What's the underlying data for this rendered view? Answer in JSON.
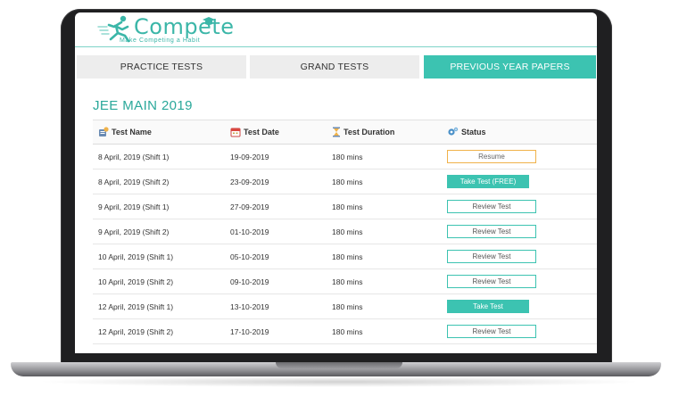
{
  "brand": {
    "name": "Compete",
    "tagline": "Make Competing a Habit",
    "accent": "#3cc3b1"
  },
  "tabs": [
    {
      "label": "PRACTICE TESTS",
      "active": false
    },
    {
      "label": "GRAND TESTS",
      "active": false
    },
    {
      "label": "PREVIOUS YEAR PAPERS",
      "active": true
    }
  ],
  "section": {
    "title": "JEE MAIN 2019"
  },
  "table": {
    "headers": {
      "name": "Test Name",
      "date": "Test Date",
      "duration": "Test Duration",
      "status": "Status"
    },
    "rows": [
      {
        "name": "8 April, 2019 (Shift 1)",
        "date": "19-09-2019",
        "duration": "180 mins",
        "action": "Resume",
        "kind": "resume"
      },
      {
        "name": "8 April, 2019 (Shift 2)",
        "date": "23-09-2019",
        "duration": "180 mins",
        "action": "Take Test (FREE)",
        "kind": "take"
      },
      {
        "name": "9 April, 2019 (Shift 1)",
        "date": "27-09-2019",
        "duration": "180 mins",
        "action": "Review Test",
        "kind": "review"
      },
      {
        "name": "9 April, 2019 (Shift 2)",
        "date": "01-10-2019",
        "duration": "180 mins",
        "action": "Review Test",
        "kind": "review"
      },
      {
        "name": "10 April, 2019 (Shift 1)",
        "date": "05-10-2019",
        "duration": "180 mins",
        "action": "Review Test",
        "kind": "review"
      },
      {
        "name": "10 April, 2019 (Shift 2)",
        "date": "09-10-2019",
        "duration": "180 mins",
        "action": "Review Test",
        "kind": "review"
      },
      {
        "name": "12 April, 2019 (Shift 1)",
        "date": "13-10-2019",
        "duration": "180 mins",
        "action": "Take Test",
        "kind": "take"
      },
      {
        "name": "12 April, 2019 (Shift 2)",
        "date": "17-10-2019",
        "duration": "180 mins",
        "action": "Review Test",
        "kind": "review"
      }
    ]
  }
}
